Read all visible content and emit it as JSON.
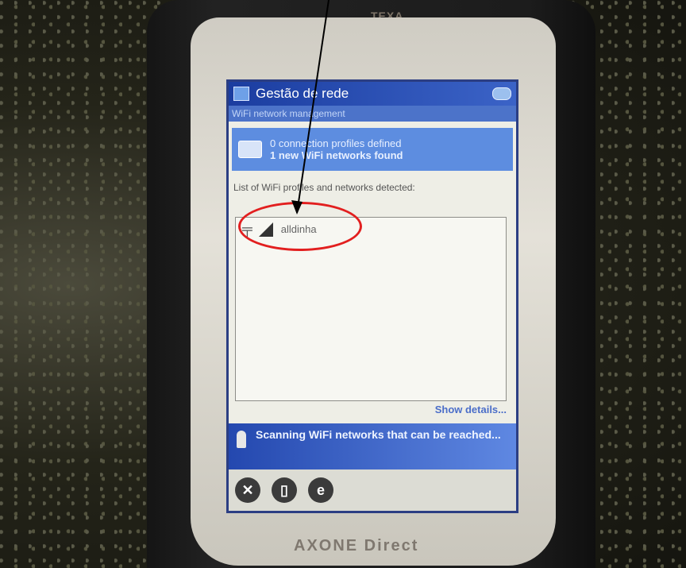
{
  "device": {
    "top_brand": "TEXA",
    "bottom_brand": "AXONE Direct"
  },
  "app": {
    "title": "Gestão de rede",
    "subtitle": "WiFi network management",
    "summary_line_1": "0 connection profiles defined",
    "summary_line_2": "1 new WiFi networks found",
    "list_label": "List of WiFi profiles and networks detected:",
    "networks": [
      {
        "name": "alldinha",
        "antenna_icon": "antenna-icon",
        "signal_icon": "signal-strength-icon"
      }
    ],
    "show_details": "Show details...",
    "status": "Scanning WiFi networks that can be reached..."
  },
  "toolbar": {
    "buttons": [
      {
        "icon": "close-icon",
        "glyph": "✕"
      },
      {
        "icon": "device-settings-icon",
        "glyph": "▯"
      },
      {
        "icon": "internet-explorer-icon",
        "glyph": "e"
      }
    ]
  },
  "annotation": {
    "circle_color": "#e21f1f",
    "arrow_color": "#000000"
  }
}
